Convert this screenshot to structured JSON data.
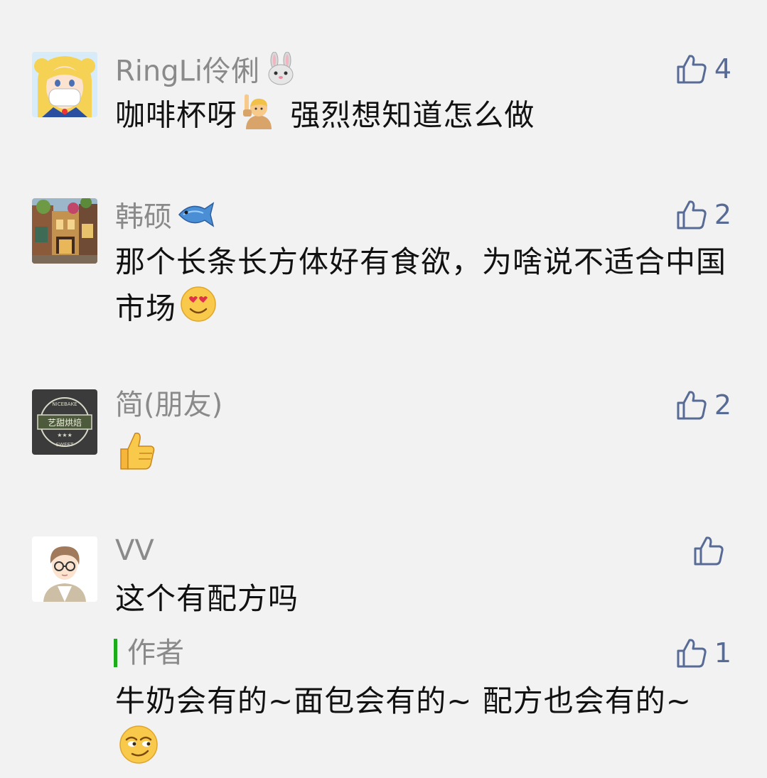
{
  "comments": [
    {
      "nickname": "RingLi伶俐",
      "nickname_emoji": "rabbit-face-icon",
      "likes": "4",
      "content_before": "咖啡杯呀",
      "content_emoji": "person-raising-hand-icon",
      "content_after": " 强烈想知道怎么做"
    },
    {
      "nickname": "韩硕",
      "nickname_emoji": "fish-icon",
      "likes": "2",
      "content": "那个长条长方体好有食欲，为啥说不适合中国市场",
      "content_emoji": "heart-eyes-face-icon"
    },
    {
      "nickname": "简(朋友)",
      "likes": "2",
      "avatar_text": "艺甜烘焙",
      "avatar_ring_top": "NICEBAKE",
      "avatar_ring_bottom": "SWEET",
      "content_emoji": "thumbs-up-icon"
    },
    {
      "nickname": "VV",
      "likes": "",
      "content": "这个有配方吗",
      "reply": {
        "label": "作者",
        "likes": "1",
        "content": "牛奶会有的~面包会有的~ 配方也会有的~",
        "content_emoji": "smirking-face-icon"
      }
    }
  ],
  "colors": {
    "background": "#f2f2f2",
    "nickname": "#8a8a8a",
    "like": "#576b95",
    "content": "#111111",
    "author_bar": "#1aad19"
  }
}
